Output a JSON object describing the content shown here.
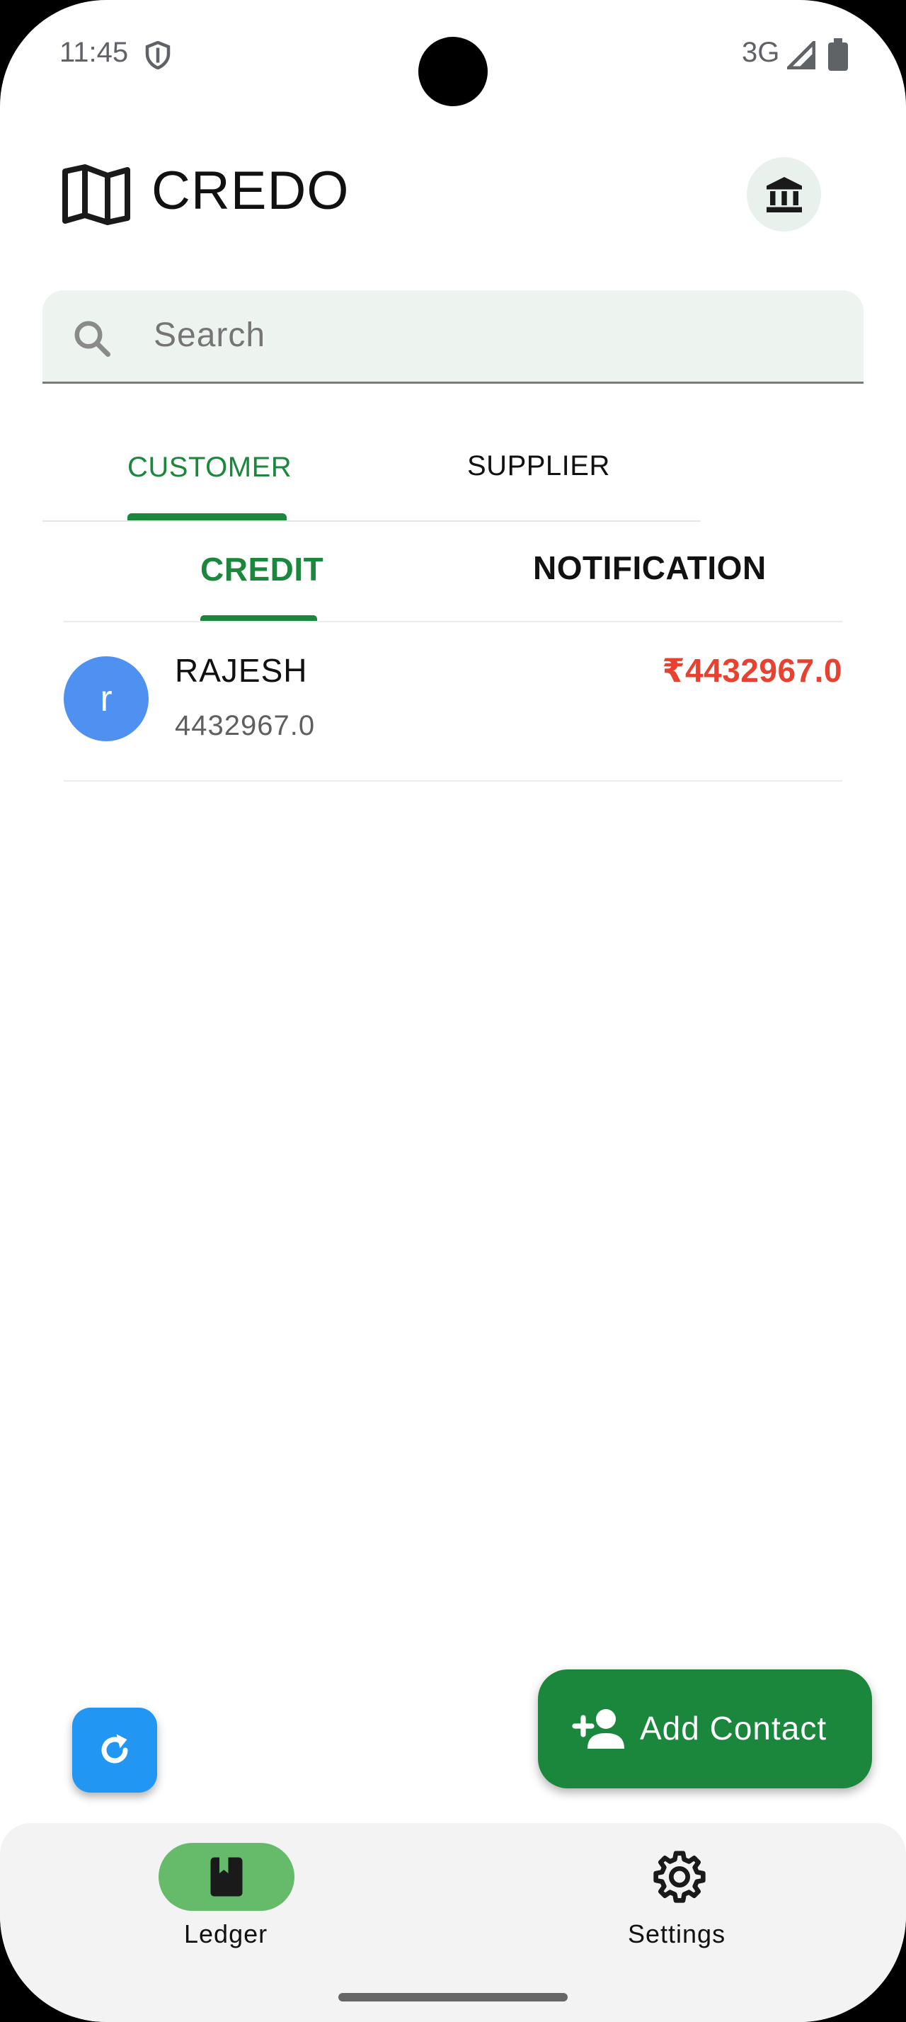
{
  "status_bar": {
    "time": "11:45",
    "network": "3G"
  },
  "header": {
    "title": "CREDO"
  },
  "search": {
    "placeholder": "Search"
  },
  "tabs": [
    {
      "label": "CUSTOMER",
      "selected": true
    },
    {
      "label": "SUPPLIER",
      "selected": false
    }
  ],
  "sub_tabs": [
    {
      "label": "CREDIT",
      "selected": true
    },
    {
      "label": "NOTIFICATION",
      "selected": false
    }
  ],
  "customers": [
    {
      "initial": "r",
      "name": "RAJESH",
      "subtitle": "4432967.0",
      "amount": "₹4432967.0",
      "avatar_color": "#4e91f1",
      "amount_color": "#e8412f"
    }
  ],
  "fab": {
    "add_contact_label": "Add Contact"
  },
  "bottom_nav": {
    "items": [
      {
        "label": "Ledger",
        "active": true
      },
      {
        "label": "Settings",
        "active": false
      }
    ]
  },
  "colors": {
    "accent": "#1b873d",
    "refresh": "#2196f3",
    "nav_active_pill": "#66bb6a"
  }
}
